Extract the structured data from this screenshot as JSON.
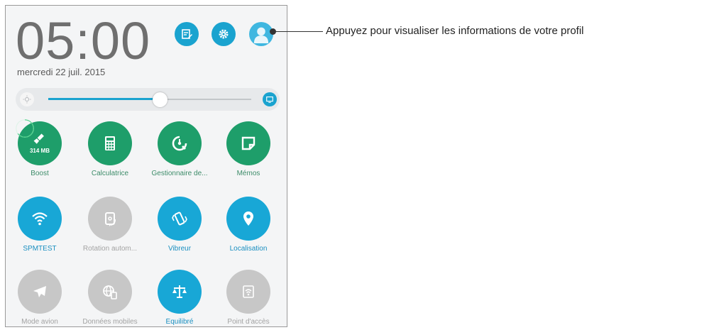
{
  "status": {
    "time": "05:00",
    "date": "mercredi 22 juil. 2015"
  },
  "header_buttons": [
    {
      "icon": "edit-note-icon"
    },
    {
      "icon": "gear-icon"
    },
    {
      "icon": "profile-icon"
    }
  ],
  "brightness": {
    "level_percent": 55
  },
  "tiles": [
    {
      "label": "Boost",
      "icon": "broom-icon",
      "state": "green",
      "badge": "314 MB"
    },
    {
      "label": "Calculatrice",
      "icon": "calculator-icon",
      "state": "green"
    },
    {
      "label": "Gestionnaire de...",
      "icon": "task-manager-icon",
      "state": "green"
    },
    {
      "label": "Mémos",
      "icon": "memo-icon",
      "state": "green"
    },
    {
      "label": "SPMTEST",
      "icon": "wifi-icon",
      "state": "blue"
    },
    {
      "label": "Rotation autom...",
      "icon": "rotation-icon",
      "state": "gray"
    },
    {
      "label": "Vibreur",
      "icon": "vibrate-icon",
      "state": "blue"
    },
    {
      "label": "Localisation",
      "icon": "location-icon",
      "state": "blue"
    },
    {
      "label": "Mode avion",
      "icon": "airplane-icon",
      "state": "gray"
    },
    {
      "label": "Données mobiles",
      "icon": "mobile-data-icon",
      "state": "gray"
    },
    {
      "label": "Équilibré",
      "icon": "balance-icon",
      "state": "blue"
    },
    {
      "label": "Point d'accès",
      "icon": "hotspot-icon",
      "state": "gray"
    }
  ],
  "callout": {
    "text": "Appuyez pour visualiser les informations de votre profil"
  },
  "colors": {
    "accent_blue": "#18a7d6",
    "accent_green": "#1e9e6a",
    "inactive_gray": "#c7c7c7"
  }
}
